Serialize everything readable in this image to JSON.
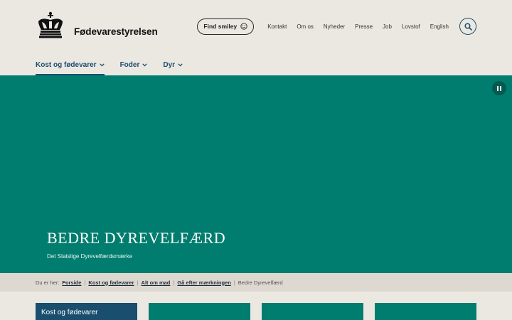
{
  "header": {
    "brand": "Fødevarestyrelsen",
    "logo_icon": "crown-icon",
    "find_smiley": "Find smiley",
    "top_links": [
      "Kontakt",
      "Om os",
      "Nyheder",
      "Presse",
      "Job",
      "Lovstof",
      "English"
    ],
    "search_icon": "search-icon"
  },
  "nav": {
    "items": [
      {
        "label": "Kost og fødevarer",
        "active": true
      },
      {
        "label": "Foder",
        "active": false
      },
      {
        "label": "Dyr",
        "active": false
      }
    ]
  },
  "hero": {
    "title": "BEDRE DYREVELFÆRD",
    "subtitle": "Det Statslige Dyrevelfærdsmærke",
    "color": "#007d6e"
  },
  "breadcrumb": {
    "prefix": "Du er her:",
    "links": [
      "Forside",
      "Kost og fødevarer",
      "Alt om mad",
      "Gå efter mærkningen"
    ],
    "current": "Bedre Dyrevelfærd"
  },
  "cards": {
    "first_title": "Kost og fødevarer"
  },
  "colors": {
    "accent": "#1d4d6e",
    "green": "#007d6e",
    "background": "#ebe8e2"
  }
}
